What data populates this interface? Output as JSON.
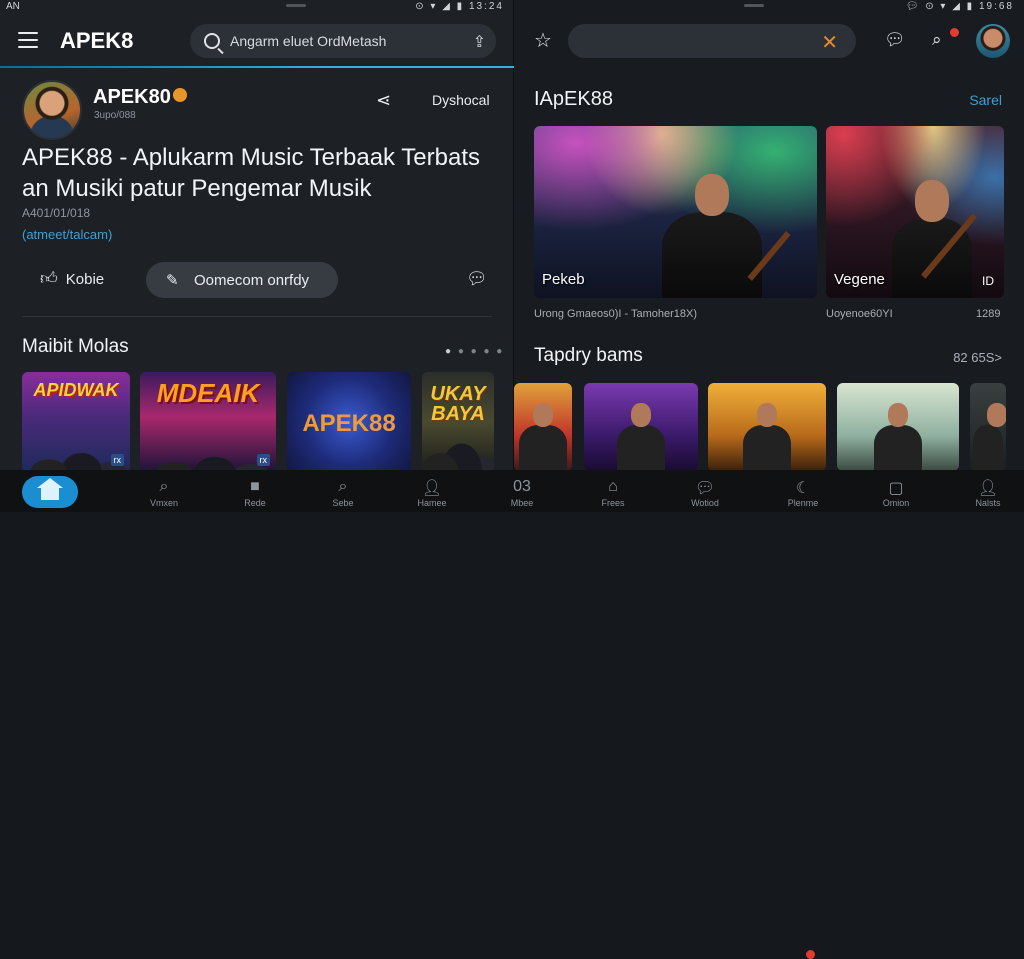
{
  "left": {
    "status": {
      "left": "AN",
      "right": "13:24"
    },
    "brand": "APEK8",
    "search_text": "Angarm eluet OrdMetash",
    "profile": {
      "name": "APEK80",
      "handle": "3upo/088",
      "download": "Dyshocal"
    },
    "headline": "APEK88 - Aplukarm Music Terbaak Terbats an Musiki patur Pengemar Musik",
    "date": "A401/01/018",
    "tag": "(atmeet/talcam)",
    "like_label": "Kobie",
    "pill_label": "Oomecom onrfdy",
    "section_title": "Maibit Molas",
    "cards": [
      {
        "text": "APIDWAK",
        "badge": "rx"
      },
      {
        "text": "MDEAIK",
        "badge": "rx"
      },
      {
        "text": "APEK88"
      },
      {
        "text": "UKAY BAYA"
      }
    ]
  },
  "right": {
    "status": {
      "right": "19:68"
    },
    "section1_title": "IApEK88",
    "see_all": "Sarel",
    "hero": [
      {
        "caption": "Pekeb",
        "subtitle": "Urong Gmaeos0)I - Tamoher18X)"
      },
      {
        "caption": "Vegene",
        "tag": "ID",
        "subtitle": "Uoyenoe60YI",
        "time": "1289"
      }
    ],
    "section2_title": "Tapdry bams",
    "section2_more": "82 65S>"
  },
  "nav": [
    {
      "label": "Vmxen",
      "icon": "search-icon"
    },
    {
      "label": "Rede",
      "icon": "square-icon"
    },
    {
      "label": "Sebe",
      "icon": "search-icon"
    },
    {
      "label": "Hamee",
      "icon": "person-icon"
    },
    {
      "label": "Mbee",
      "glyph": "03"
    },
    {
      "label": "Frees",
      "icon": "home-icon"
    },
    {
      "label": "Wotiod",
      "icon": "chat-icon"
    },
    {
      "label": "Plenme",
      "icon": "moon-icon"
    },
    {
      "label": "Omion",
      "icon": "square-icon"
    },
    {
      "label": "Nalsts",
      "icon": "person-icon"
    }
  ],
  "colors": {
    "accent": "#1a8ed1",
    "link": "#3d9fd6",
    "close": "#e58a2e",
    "notify": "#e53b2e"
  }
}
